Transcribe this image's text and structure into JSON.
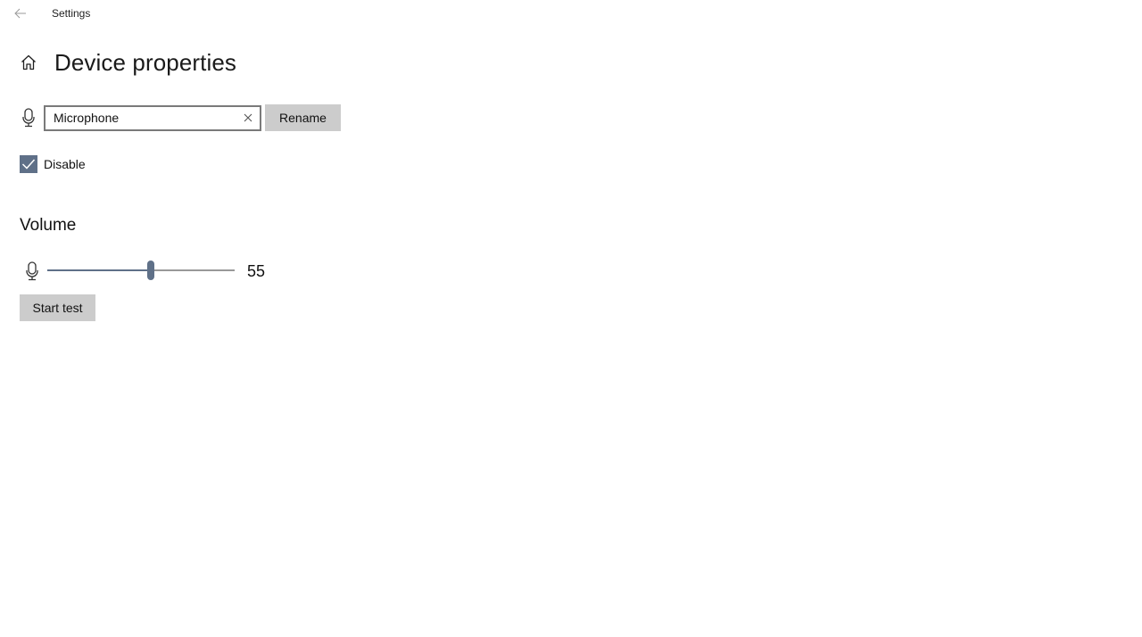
{
  "window": {
    "app_title": "Settings",
    "back_icon": "arrow-left-icon"
  },
  "header": {
    "home_icon": "home-icon",
    "title": "Device properties"
  },
  "device": {
    "icon": "microphone-icon",
    "name_value": "Microphone",
    "clear_icon": "close-icon",
    "rename_label": "Rename"
  },
  "disable": {
    "label": "Disable",
    "checked": true
  },
  "volume": {
    "section_title": "Volume",
    "icon": "microphone-icon",
    "value": 55,
    "value_text": "55",
    "min": 0,
    "max": 100
  },
  "actions": {
    "start_test_label": "Start test"
  },
  "colors": {
    "accent": "#5f7088",
    "button_bg": "#cccccc",
    "track": "#999999"
  }
}
